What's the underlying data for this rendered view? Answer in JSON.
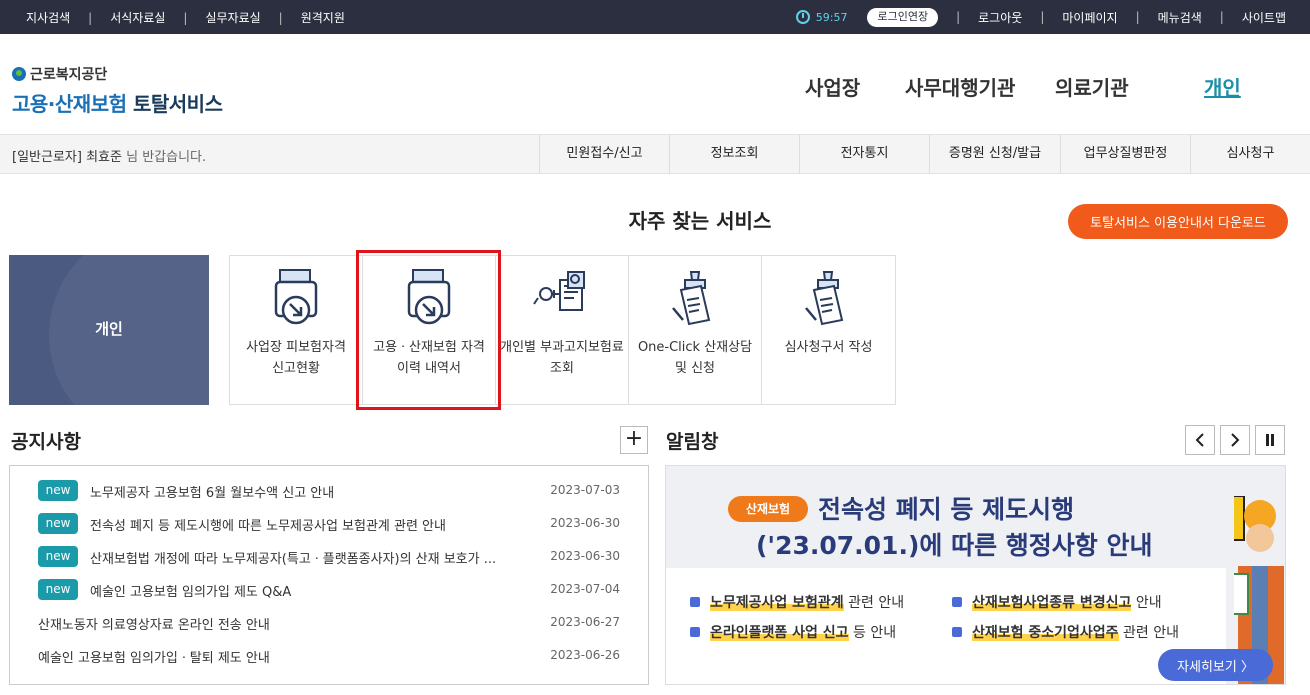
{
  "topbar": {
    "left_links": [
      "지사검색",
      "서식자료실",
      "실무자료실",
      "원격지원"
    ],
    "timer": "59:57",
    "extend_label": "로그인연장",
    "right_links": [
      "로그아웃",
      "마이페이지",
      "메뉴검색",
      "사이트맵"
    ]
  },
  "logo": {
    "org": "근로복지공단",
    "service_blue": "고용·산재보험",
    "service_dark": "토탈서비스"
  },
  "mainnav": [
    "사업장",
    "사무대행기관",
    "의료기관",
    "개인"
  ],
  "subbar": {
    "welcome_prefix": "[일반근로자] 최효준",
    "welcome_suffix": " 님 반갑습니다.",
    "menu": [
      "민원접수/신고",
      "정보조회",
      "전자통지",
      "증명원 신청/발급",
      "업무상질병판정",
      "심사청구"
    ]
  },
  "frequent": {
    "title": "자주 찾는 서비스",
    "guide_button": "토탈서비스 이용안내서 다운로드",
    "banner_label": "개인",
    "items": [
      {
        "label": "사업장 피보험자격 신고현황",
        "icon": "printer-document-icon"
      },
      {
        "label": "고용ㆍ산재보험 자격 이력 내역서",
        "icon": "printer-document-icon"
      },
      {
        "label": "개인별 부과고지보험료 조회",
        "icon": "receipt-search-icon"
      },
      {
        "label": "One-Click 산재상담 및 신청",
        "icon": "stamp-document-icon"
      },
      {
        "label": "심사청구서 작성",
        "icon": "stamp-document-icon"
      }
    ]
  },
  "notice": {
    "title": "공지사항",
    "more_label": "+",
    "badge_label": "new",
    "rows": [
      {
        "title": "노무제공자 고용보험 6월 월보수액 신고 안내",
        "date": "2023-07-03",
        "new": true
      },
      {
        "title": "전속성 폐지 등 제도시행에 따른 노무제공사업 보험관계 관련 안내",
        "date": "2023-06-30",
        "new": true
      },
      {
        "title": "산재보험법 개정에 따라 노무제공자(특고ㆍ플랫폼종사자)의 산재 보호가 ...",
        "date": "2023-06-30",
        "new": true
      },
      {
        "title": "예술인 고용보험 임의가입 제도 Q&A",
        "date": "2023-07-04",
        "new": true
      },
      {
        "title": "산재노동자 의료영상자료 온라인 전송 안내",
        "date": "2023-06-27",
        "new": false
      },
      {
        "title": "예술인 고용보험 임의가입ㆍ탈퇴 제도 안내",
        "date": "2023-06-26",
        "new": false
      }
    ]
  },
  "alarm": {
    "title": "알림창",
    "tag": "산재보험",
    "line1": "전속성 폐지 등 제도시행",
    "line2": "('23.07.01.)에 따른 행정사항 안내",
    "items": [
      {
        "bold": "노무제공사업 보험관계",
        "rest": " 관련 안내"
      },
      {
        "bold": "산재보험사업종류 변경신고",
        "rest": " 안내"
      },
      {
        "bold": "온라인플랫폼 사업 신고",
        "rest": " 등 안내"
      },
      {
        "bold": "산재보험 중소기업사업주",
        "rest": " 관련 안내"
      }
    ],
    "detail_button": "자세히보기 〉"
  }
}
